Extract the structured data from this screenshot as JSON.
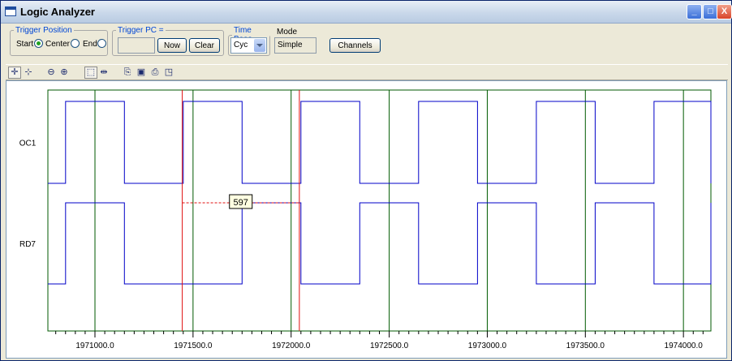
{
  "window": {
    "title": "Logic Analyzer"
  },
  "trigger_position": {
    "legend": "Trigger Position",
    "options": [
      "Start",
      "Center",
      "End"
    ],
    "selected": "Start"
  },
  "trigger_pc": {
    "legend": "Trigger PC =",
    "value": "",
    "now_label": "Now",
    "clear_label": "Clear"
  },
  "time_base": {
    "legend": "Time Base",
    "selected": "Cyc"
  },
  "mode": {
    "label": "Mode",
    "value": "Simple"
  },
  "channels_button": "Channels",
  "toolbar_icons": [
    "pan-icon",
    "zoom-fit-icon",
    "zoom-out-icon",
    "zoom-in-icon",
    "select-region-icon",
    "cursor-measure-icon",
    "copy-icon",
    "save-icon",
    "print-icon",
    "print-preview-icon"
  ],
  "colors": {
    "signal": "#0000c8",
    "grid": "#005a00",
    "cursor": "#e01010",
    "plot_bg": "#ffffff"
  },
  "chart_data": {
    "type": "line",
    "x_range": [
      1970760,
      1974140
    ],
    "x_ticks": [
      {
        "value": 1971000,
        "label": "1971000.0"
      },
      {
        "value": 1971500,
        "label": "1971500.0"
      },
      {
        "value": 1972000,
        "label": "1972000.0"
      },
      {
        "value": 1972500,
        "label": "1972500.0"
      },
      {
        "value": 1973000,
        "label": "1973000.0"
      },
      {
        "value": 1973500,
        "label": "1973500.0"
      },
      {
        "value": 1974000,
        "label": "1974000.0"
      }
    ],
    "series": [
      {
        "name": "OC1",
        "initial": 0,
        "transitions": [
          1970850,
          1971150,
          1971450,
          1971750,
          1972050,
          1972350,
          1972650,
          1972950,
          1973250,
          1973550,
          1973850,
          1974140
        ]
      },
      {
        "name": "RD7",
        "initial": 0,
        "transitions": [
          1970850,
          1971150,
          1971750,
          1972050,
          1972350,
          1972650,
          1972950,
          1973250,
          1973550,
          1973850,
          1974140
        ]
      }
    ],
    "cursors": [
      1971445,
      1972042
    ],
    "cursor_delta_label": "597"
  }
}
